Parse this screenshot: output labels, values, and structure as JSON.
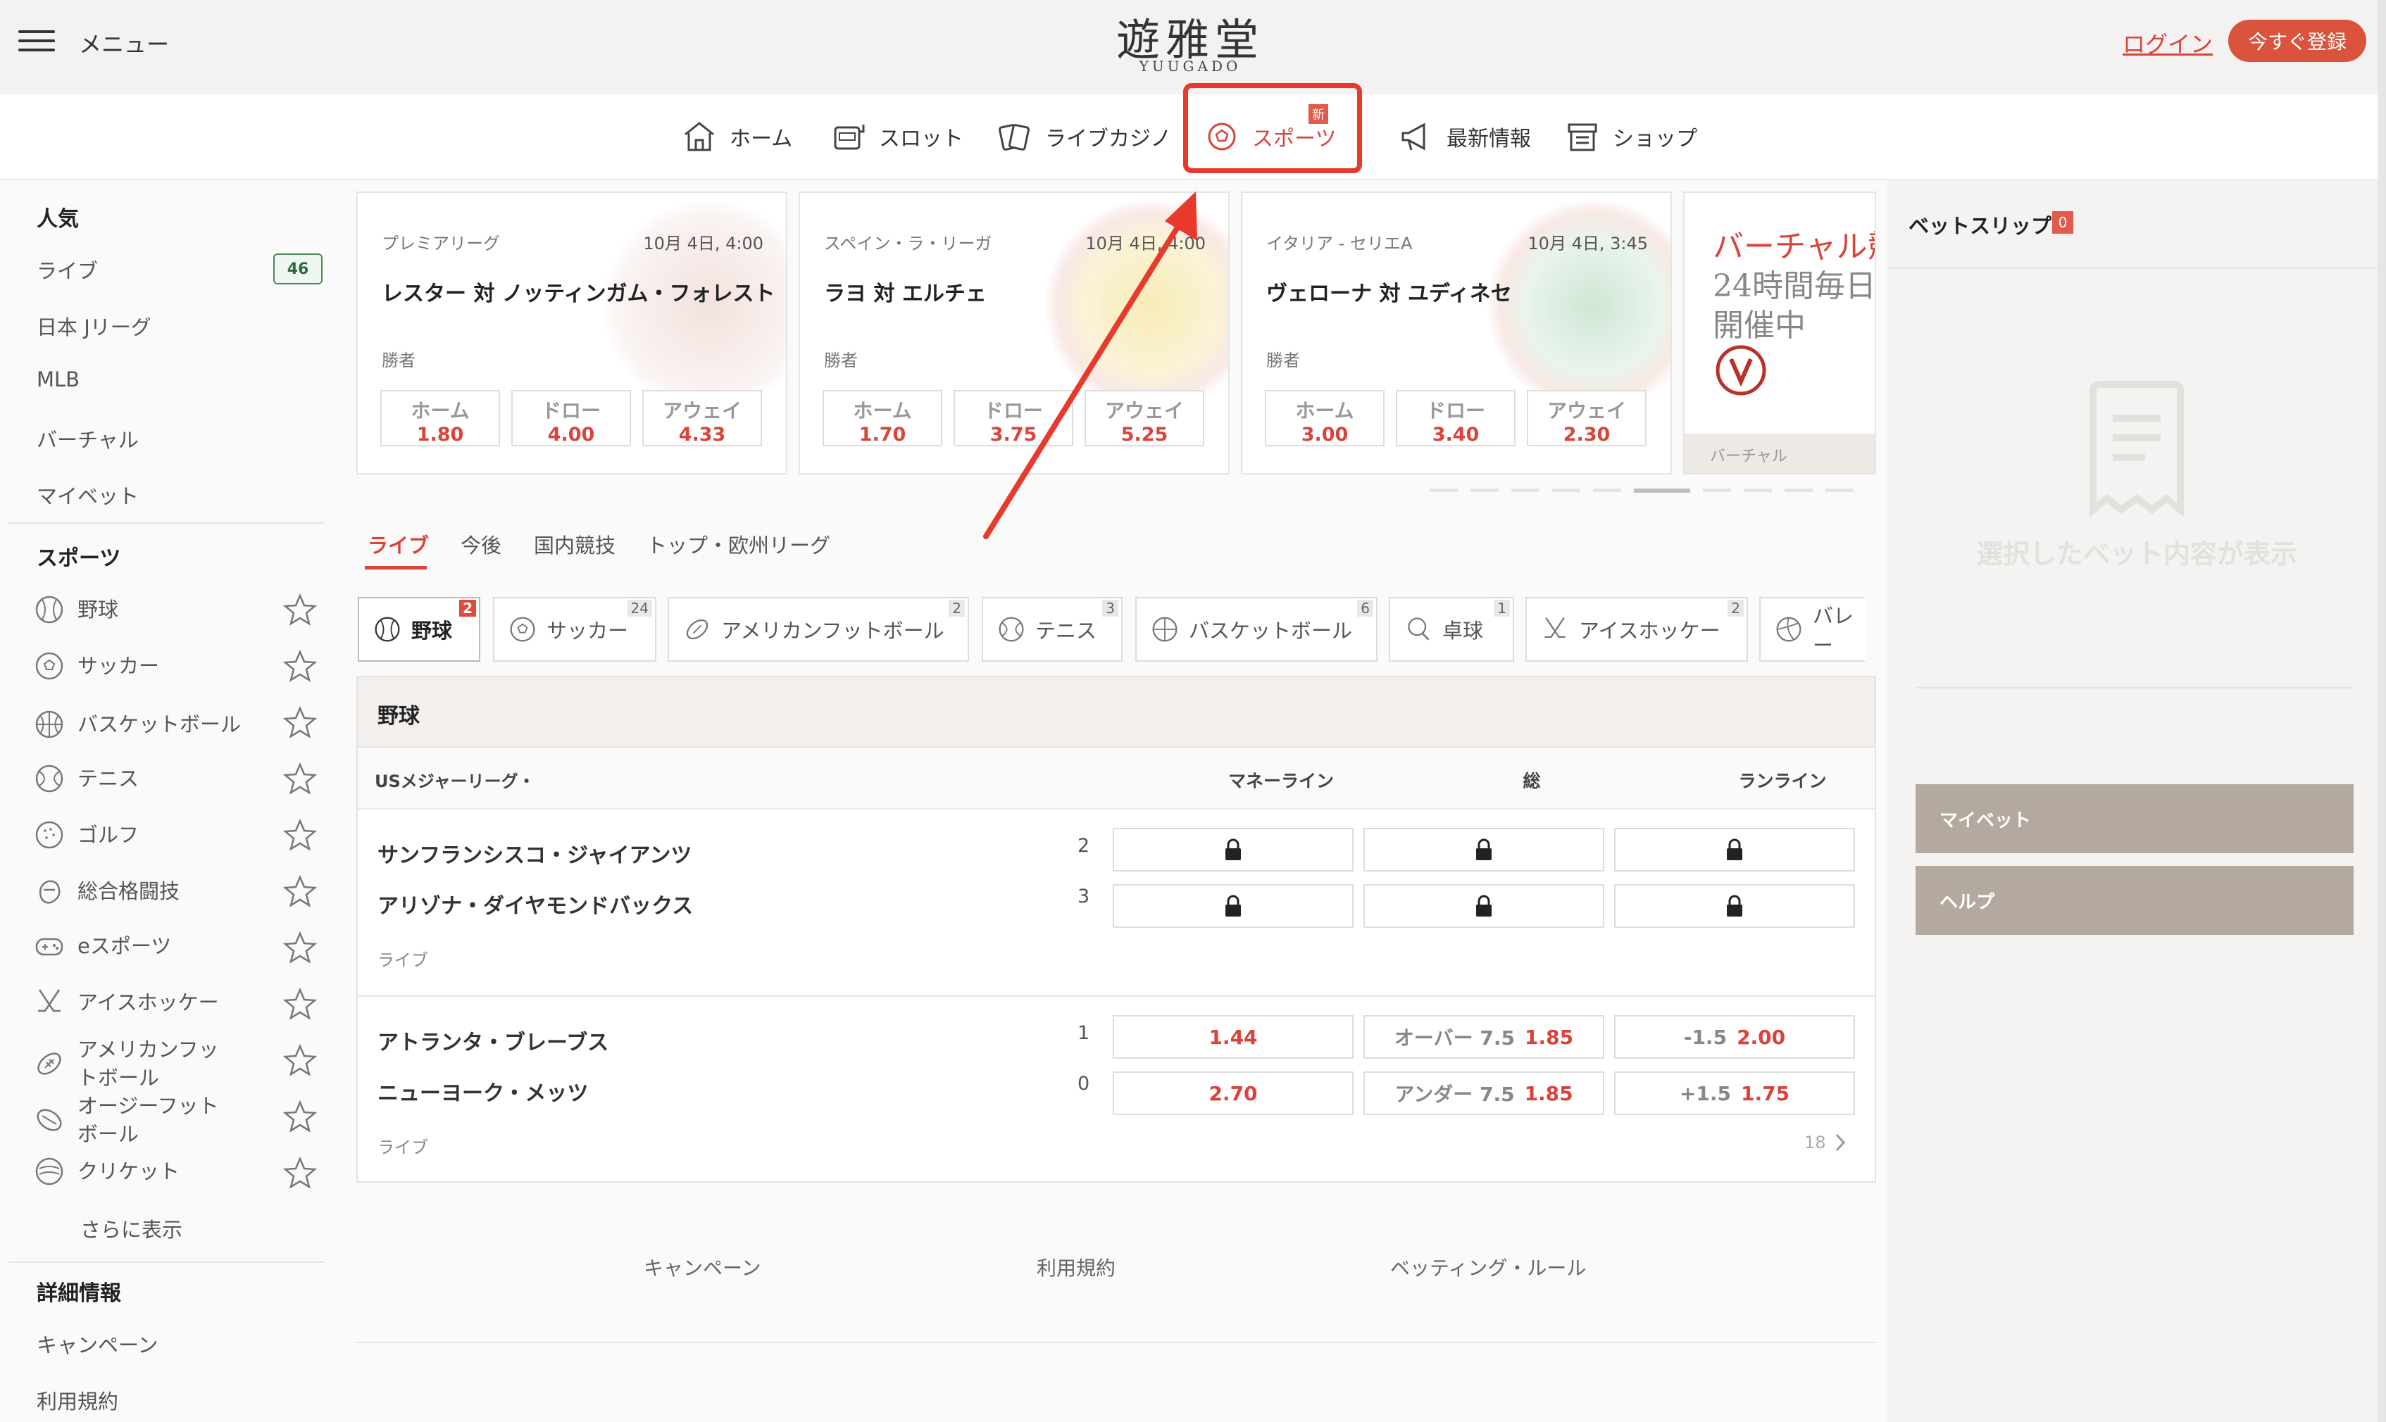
{
  "header": {
    "menu_label": "メニュー",
    "logo_text": "遊雅堂",
    "logo_sub": "YUUGADO",
    "login": "ログイン",
    "register": "今すぐ登録"
  },
  "nav": [
    {
      "label": "ホーム",
      "icon": "home-icon"
    },
    {
      "label": "スロット",
      "icon": "slot-icon"
    },
    {
      "label": "ライブカジノ",
      "icon": "cards-icon"
    },
    {
      "label": "スポーツ",
      "icon": "soccer-ball-icon",
      "badge": "新",
      "active": true
    },
    {
      "label": "最新情報",
      "icon": "megaphone-icon"
    },
    {
      "label": "ショップ",
      "icon": "shop-icon"
    }
  ],
  "sidebar": {
    "popular_title": "人気",
    "popular": [
      {
        "label": "ライブ",
        "count": "46"
      },
      {
        "label": "日本 Jリーグ"
      },
      {
        "label": "MLB"
      },
      {
        "label": "バーチャル"
      },
      {
        "label": "マイベット"
      }
    ],
    "sports_title": "スポーツ",
    "sports": [
      {
        "label": "野球",
        "icon": "baseball-icon"
      },
      {
        "label": "サッカー",
        "icon": "soccer-icon"
      },
      {
        "label": "バスケットボール",
        "icon": "basketball-icon"
      },
      {
        "label": "テニス",
        "icon": "tennis-icon"
      },
      {
        "label": "ゴルフ",
        "icon": "golf-icon"
      },
      {
        "label": "総合格闘技",
        "icon": "mma-icon"
      },
      {
        "label": "eスポーツ",
        "icon": "gamepad-icon"
      },
      {
        "label": "アイスホッケー",
        "icon": "hockey-icon"
      },
      {
        "label": "アメリカンフットボール",
        "icon": "football-icon"
      },
      {
        "label": "オージーフットボール",
        "icon": "aussie-football-icon"
      },
      {
        "label": "クリケット",
        "icon": "cricket-icon"
      }
    ],
    "show_more": "さらに表示",
    "info_title": "詳細情報",
    "info": [
      {
        "label": "キャンペーン"
      },
      {
        "label": "利用規約"
      }
    ]
  },
  "cards": [
    {
      "league": "プレミアリーグ",
      "date": "10月 4日, 4:00",
      "match": "レスター 対 ノッティンガム・フォレスト",
      "sub": "勝者",
      "odds": [
        {
          "label": "ホーム",
          "value": "1.80"
        },
        {
          "label": "ドロー",
          "value": "4.00"
        },
        {
          "label": "アウェイ",
          "value": "4.33"
        }
      ]
    },
    {
      "league": "スペイン・ラ・リーガ",
      "date": "10月 4日, 4:00",
      "match": "ラヨ 対 エルチェ",
      "sub": "勝者",
      "odds": [
        {
          "label": "ホーム",
          "value": "1.70"
        },
        {
          "label": "ドロー",
          "value": "3.75"
        },
        {
          "label": "アウェイ",
          "value": "5.25"
        }
      ]
    },
    {
      "league": "イタリア - セリエA",
      "date": "10月 4日, 3:45",
      "match": "ヴェローナ 対 ユディネセ",
      "sub": "勝者",
      "odds": [
        {
          "label": "ホーム",
          "value": "3.00"
        },
        {
          "label": "ドロー",
          "value": "3.40"
        },
        {
          "label": "アウェイ",
          "value": "2.30"
        }
      ]
    }
  ],
  "virtual_card": {
    "line1": "バーチャル競",
    "line2": "24時間毎日",
    "line3": "開催中",
    "footer": "バーチャル"
  },
  "tabs": [
    "ライブ",
    "今後",
    "国内競技",
    "トップ・欧州リーグ"
  ],
  "chips": [
    {
      "label": "野球",
      "count": "2",
      "icon": "baseball-icon",
      "active": true
    },
    {
      "label": "サッカー",
      "count": "24",
      "icon": "soccer-icon"
    },
    {
      "label": "アメリカンフットボール",
      "count": "2",
      "icon": "football-icon"
    },
    {
      "label": "テニス",
      "count": "3",
      "icon": "tennis-icon"
    },
    {
      "label": "バスケットボール",
      "count": "6",
      "icon": "basketball-icon"
    },
    {
      "label": "卓球",
      "count": "1",
      "icon": "pingpong-icon"
    },
    {
      "label": "アイスホッケー",
      "count": "2",
      "icon": "hockey-icon"
    },
    {
      "label": "バレー",
      "count": "",
      "icon": "volleyball-icon"
    }
  ],
  "table": {
    "section_title": "野球",
    "league": "USメジャーリーグ・",
    "col_moneyline": "マネーライン",
    "col_total": "総",
    "col_runline": "ランライン",
    "matches": [
      {
        "team1": "サンフランシスコ・ジャイアンツ",
        "score1": "2",
        "team2": "アリゾナ・ダイヤモンドバックス",
        "score2": "3",
        "status": "ライブ",
        "locked": true
      },
      {
        "team1": "アトランタ・ブレーブス",
        "score1": "1",
        "team2": "ニューヨーク・メッツ",
        "score2": "0",
        "status": "ライブ",
        "locked": false,
        "row1": {
          "ml": "1.44",
          "total_label": "オーバー 7.5",
          "total": "1.85",
          "rl_label": "-1.5",
          "rl": "2.00"
        },
        "row2": {
          "ml": "2.70",
          "total_label": "アンダー 7.5",
          "total": "1.85",
          "rl_label": "+1.5",
          "rl": "1.75"
        },
        "more": "18"
      }
    ]
  },
  "footer_links": [
    "キャンペーン",
    "利用規約",
    "ベッティング・ルール"
  ],
  "betslip": {
    "title": "ベットスリップ",
    "count": "0",
    "empty": "選択したベット内容が表示",
    "mybet": "マイベット",
    "help": "ヘルプ"
  },
  "colors": {
    "accent": "#d9433a",
    "annotation": "#e8392c",
    "sidebar_button": "#b3a99f"
  }
}
